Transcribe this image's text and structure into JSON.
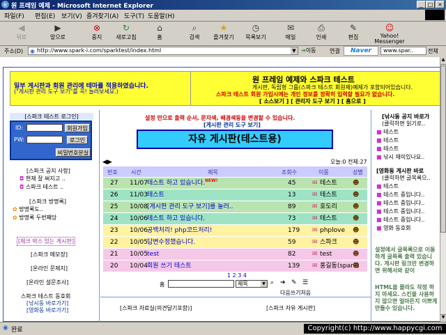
{
  "window": {
    "title": "원 프레임 예제 - Microsoft Internet Explorer"
  },
  "menu": [
    "파일(F)",
    "편집(E)",
    "보기(V)",
    "즐겨찾기(A)",
    "도구(T)",
    "도움말(H)"
  ],
  "toolbar": [
    "뒤로",
    "앞으로",
    "중지",
    "새로고침",
    "홈",
    "검색",
    "즐겨찾기",
    "목록보기",
    "메일",
    "인쇄",
    "편집",
    "Yahoo! Messenger"
  ],
  "address": {
    "label": "주소(D)",
    "url": "http://www.spark-i.com/sparktest/index.html",
    "go": "이동",
    "links": "연결",
    "naver": "Naver",
    "search_val": "www.spar..",
    "all": "전체"
  },
  "top": {
    "left_line1": "일부 게시판과 회원 관리에 테마를 적용하였습니다.",
    "left_line2": "(\"게시판 관리 도구 보기\"를 꼭! 눌러보세요.)",
    "title": "원 프레임 예제와 스파크 테스트",
    "desc1": "게시판, 독립형 그룹(스파크 테스트 회원제)예제가 포함되어있습니다.",
    "desc2": "스파크 테스트 회원 가입시에는 개인 정보를 정확히 입력할 필요가 없습니다.",
    "links": "[ 소스보기 ] [ 관리자 도구 보기 ] [ 홈으로 ]"
  },
  "login": {
    "title": "[스파크 테스트 로그인]",
    "id_label": "ID:",
    "pw_label": "PW:",
    "join": "회원가입",
    "login": "로그인",
    "find": "비밀번호분실"
  },
  "notice": {
    "title": "[스파크 공지 사항]",
    "items": [
      "현재 잘 써지고 ..",
      "스파크 테스트 .."
    ]
  },
  "guestbook": {
    "title": "[스파크 방명록]",
    "items": [
      "방명록도..",
      "방명록 두번째당"
    ]
  },
  "left_links": [
    "[체크 박스 있는 게시판]",
    "[스파크 메모장]",
    "[온라인 문제지]",
    "[온라인 설문조사]"
  ],
  "club": {
    "title": "스파크 테스트 동호회",
    "items": [
      "[낚시동 바로가기]",
      "[영화동 바로가기]"
    ]
  },
  "center": {
    "notice": "설정 만으로 출력 순서, 문자색, 배경색등을 변경할 수 있습니다.",
    "admin_link": "[게시판 관리 도구 보기]",
    "board_title": "자유 게시판(테스트용)",
    "today": "오늘:0 전체:27",
    "headers": [
      "번호",
      "시간",
      "제목",
      "조회수",
      "이름",
      "성별"
    ],
    "rows": [
      {
        "no": "27",
        "date": "11/07",
        "title": "테스트 하고 있습니다.",
        "new": "NEW!",
        "views": "45",
        "name": "테스트",
        "bg": "#b9e4b0"
      },
      {
        "no": "26",
        "date": "11/03",
        "title": "테스트",
        "new": "",
        "views": "13",
        "name": "테스트",
        "bg": "#9ee4c4"
      },
      {
        "no": "25",
        "date": "10/08",
        "title": "[게시판 관리 도구 보기]를 눌러..",
        "new": "",
        "views": "89",
        "name": "호도리",
        "bg": "#b9e4b0"
      },
      {
        "no": "24",
        "date": "10/06",
        "title": "테스트 하고 있습니다.",
        "new": "",
        "views": "73",
        "name": "테스트",
        "bg": "#9ee4c4"
      },
      {
        "no": "23",
        "date": "10/06",
        "title": "공백처리! php코드처리!",
        "new": "",
        "views": "179",
        "name": "phplove",
        "bg": "#fff2a0"
      },
      {
        "no": "22",
        "date": "10/05",
        "title": "  답변수정했습니다.",
        "new": "",
        "views": "59",
        "name": "스파크",
        "bg": "#fff2a0"
      },
      {
        "no": "21",
        "date": "10/05",
        "title": "test",
        "new": "",
        "views": "82",
        "name": "test",
        "bg": "#f6c8e8"
      },
      {
        "no": "20",
        "date": "10/04",
        "title": "회원 쓰기 테스트",
        "new": "",
        "views": "139",
        "name": "홍길동(spark)",
        "bg": "#f6c8e8"
      }
    ],
    "pages": "1 2 3 4",
    "home": "홈",
    "search_select": "제목",
    "next": "다음쓰기처음",
    "sub_left": "[스파크 자료실(의견달기포함)]",
    "sub_right": "[스파크 자유 게시판]"
  },
  "right": {
    "fish_title": "[낚시동 공지 바로가",
    "fish_sub": "(클릭하면 읽기로..",
    "fish_items": [
      "테스트",
      "테스트",
      "테스트",
      "낚시 재미있나요.."
    ],
    "movie_title": "[영화동 게시판 바로",
    "movie_sub": "(클릭하면 글목록으..",
    "movie_items": [
      "테스트",
      "테스트 중입니다..",
      "테스트 중입니다..",
      "테스트 중입니다..",
      "테스트 중입니다..",
      "영화 동호회"
    ],
    "note1": "설정에서 글목록으로 이동 하게 글목록 출력 있습니다. 게시판 링크만 변경하면 위해서와 같이",
    "note2": "HTML을 몰라도 작정 하지 마세요. 스킨을 사용하지 않으면 얼마든지 이쁘게 만들수 있습니다."
  },
  "status": {
    "text": "완료",
    "copyright": "Copyright(c) http://www.happycgi.com"
  },
  "colors": {
    "accent": "#0a246a",
    "board_title_bg": "#33ccff",
    "top_bg": "#ffff33",
    "login_bg": "#3366cc"
  }
}
